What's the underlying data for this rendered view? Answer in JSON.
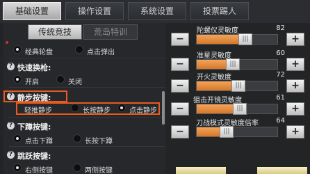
{
  "tabs": [
    {
      "label": "基础设置",
      "active": true
    },
    {
      "label": "操作设置",
      "active": false
    },
    {
      "label": "系统设置",
      "active": false
    },
    {
      "label": "投票踢人",
      "active": false
    }
  ],
  "subtabs": [
    {
      "label": "传统竞技",
      "active": true
    },
    {
      "label": "荒岛特训",
      "active": false
    }
  ],
  "sections": {
    "wheel": {
      "options": [
        {
          "label": "经典轮盘",
          "selected": true
        },
        {
          "label": "点击弹出",
          "selected": false
        }
      ]
    },
    "quick_swap": {
      "title": "快速换枪:",
      "options": [
        {
          "label": "开启",
          "selected": true
        },
        {
          "label": "关闭",
          "selected": false
        }
      ]
    },
    "quiet_step": {
      "title": "静步按键:",
      "options": [
        {
          "label": "轻推静步",
          "selected": false
        },
        {
          "label": "长按静步",
          "selected": false
        },
        {
          "label": "点击静步",
          "selected": true
        }
      ]
    },
    "crouch": {
      "title": "下蹲按键:",
      "options": [
        {
          "label": "点击下蹲",
          "selected": true
        },
        {
          "label": "长按下蹲",
          "selected": false
        }
      ]
    },
    "jump": {
      "title": "跳跃按键:",
      "options": [
        {
          "label": "右侧按键",
          "selected": true
        },
        {
          "label": "两侧按键",
          "selected": false
        }
      ]
    }
  },
  "sliders": [
    {
      "label": "陀螺仪灵敏度",
      "value": "82",
      "level": 0.55
    },
    {
      "label": "准星灵敏度",
      "value": "60",
      "level": 0.4
    },
    {
      "label": "开火灵敏度",
      "value": "72",
      "level": 0.47
    },
    {
      "label": "狙击开镜灵敏度",
      "value": "61",
      "level": 0.48
    },
    {
      "label": "刀战模式灵敏度倍率",
      "value": "64",
      "level": 0.32
    }
  ],
  "knob_glyph": "|||",
  "minus_label": "−",
  "plus_label": "+",
  "colors": {
    "accent_orange": "#d4782a",
    "highlight_border": "#e85a1f"
  }
}
